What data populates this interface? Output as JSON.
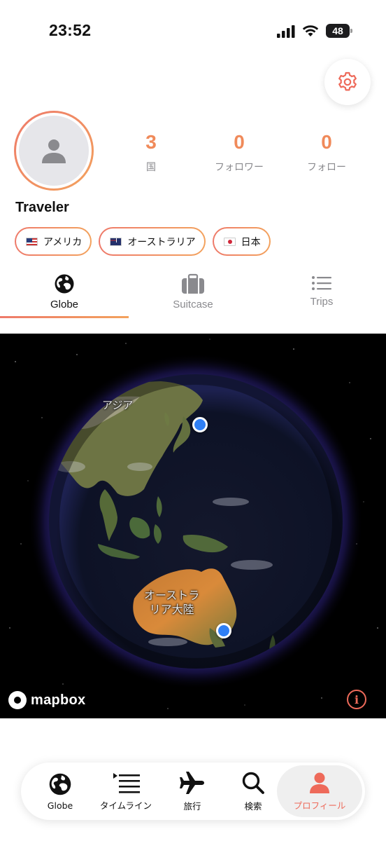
{
  "status_bar": {
    "time": "23:52",
    "battery": "48"
  },
  "profile": {
    "name": "Traveler",
    "stats": [
      {
        "value": "3",
        "label": "国"
      },
      {
        "value": "0",
        "label": "フォロワー"
      },
      {
        "value": "0",
        "label": "フォロー"
      }
    ],
    "countries": [
      {
        "flag": "us-flag-icon",
        "name": "アメリカ"
      },
      {
        "flag": "au-flag-icon",
        "name": "オーストラリア"
      },
      {
        "flag": "jp-flag-icon",
        "name": "日本"
      }
    ]
  },
  "tabs": [
    {
      "label": "Globe",
      "icon": "globe-icon",
      "active": true
    },
    {
      "label": "Suitcase",
      "icon": "suitcase-icon",
      "active": false
    },
    {
      "label": "Trips",
      "icon": "list-icon",
      "active": false
    }
  ],
  "map": {
    "labels": {
      "asia": "アジア",
      "australia_line1": "オーストラ",
      "australia_line2": "リア大陸"
    },
    "attribution": "mapbox",
    "info_symbol": "i"
  },
  "bottom_nav": [
    {
      "label": "Globe",
      "icon": "globe-icon",
      "active": false
    },
    {
      "label": "タイムライン",
      "icon": "timeline-icon",
      "active": false
    },
    {
      "label": "旅行",
      "icon": "airplane-icon",
      "active": false
    },
    {
      "label": "検索",
      "icon": "search-icon",
      "active": false
    },
    {
      "label": "プロフィール",
      "icon": "person-icon",
      "active": true
    }
  ],
  "colors": {
    "accent": "#ee7a6a",
    "accent_end": "#f3a25d",
    "pin": "#2f7ff5",
    "inactive_text": "#8a8a8e"
  }
}
